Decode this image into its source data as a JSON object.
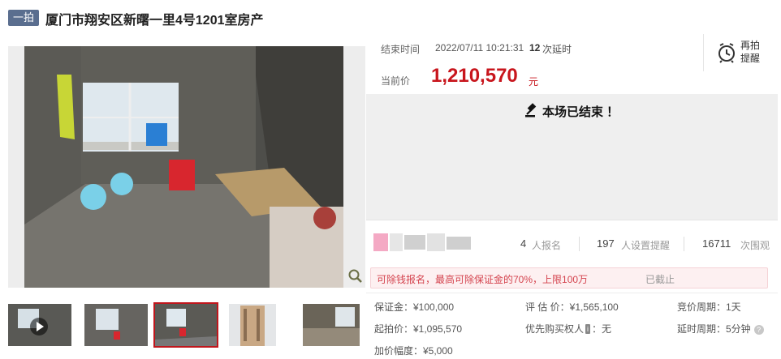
{
  "header": {
    "tag": "一拍",
    "title": "厦门市翔安区新曙一里4号1201室房产"
  },
  "auction": {
    "end_time_label": "结束时间",
    "end_time": "2022/07/11 10:21:31",
    "delay_count": "12",
    "delay_suffix": "次延时",
    "current_price_label": "当前价",
    "current_price": "1,210,570",
    "currency_unit": "元",
    "remind_label": "再拍提醒",
    "ended_text": "本场已结束 ！"
  },
  "stats": {
    "signup_count": "4",
    "signup_label": "人报名",
    "reminder_count": "197",
    "reminder_label": "人设置提醒",
    "view_count": "16711",
    "view_label": "次围观"
  },
  "notice": {
    "text": "可除钱报名，最高可除保证金的70%，上限100万",
    "status": "已截止"
  },
  "details": {
    "deposit": "保证金：¥100,000",
    "appraisal": "评 估 价：¥1,565,100",
    "bid_cycle": "竞价周期：1天",
    "start_price": "起拍价：¥1,095,570",
    "priority_label": "优先购买权人",
    "priority_badge": "i",
    "priority_value": "：无",
    "delay_cycle": "延时周期：5分钟",
    "increment": "加价幅度：¥5,000"
  },
  "colors": {
    "accent": "#c8161d",
    "tag_bg": "#5a6e8f",
    "ended_band": "#efefef"
  }
}
